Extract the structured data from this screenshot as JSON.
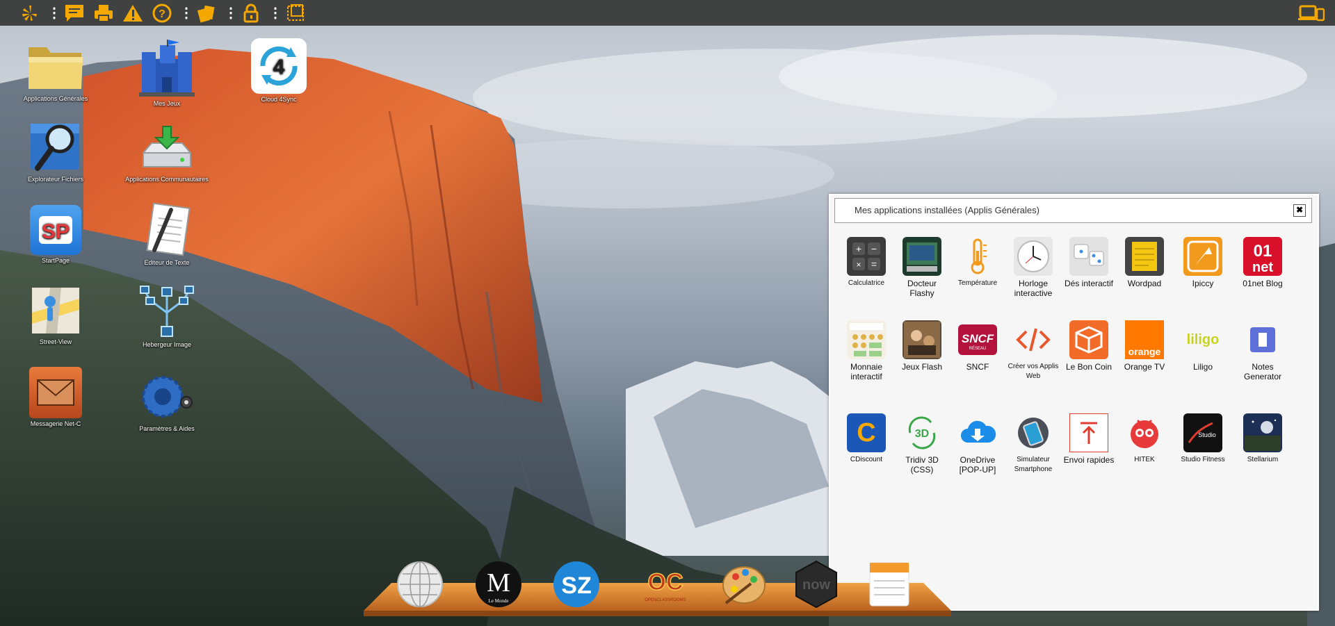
{
  "topbar": {
    "icons": [
      "yelp-icon",
      "chat-icon",
      "print-icon",
      "warning-icon",
      "help-icon",
      "notes-icon",
      "lock-icon",
      "selection-icon"
    ],
    "right_icon": "devices-icon"
  },
  "desktop": {
    "icons": [
      {
        "label": "Applications Générales",
        "icon": "folder-icon"
      },
      {
        "label": "Mes Jeux",
        "icon": "castle-icon"
      },
      {
        "label": "Cloud 4Sync",
        "icon": "cloud4sync-icon"
      },
      {
        "label": "Explorateur Fichiers",
        "icon": "magnifier-icon"
      },
      {
        "label": "Applications Communautaires",
        "icon": "download-drive-icon"
      },
      {
        "label": "StartPage",
        "icon": "startpage-icon"
      },
      {
        "label": "Editeur de Texte",
        "icon": "text-editor-icon"
      },
      {
        "label": "Street-View",
        "icon": "street-view-icon"
      },
      {
        "label": "Hebergeur Image",
        "icon": "image-host-icon"
      },
      {
        "label": "Messagerie Net-C",
        "icon": "mail-icon"
      },
      {
        "label": "Paramètres & Aides",
        "icon": "settings-icon"
      }
    ]
  },
  "window": {
    "title": "Mes applications installées (Applis Générales)",
    "close_label": "✖",
    "apps": [
      {
        "label": "Calculatrice",
        "icon": "calculator-icon"
      },
      {
        "label": "Docteur Flashy",
        "icon": "flashy-icon"
      },
      {
        "label": "Température",
        "icon": "thermometer-icon"
      },
      {
        "label": "Horloge interactive",
        "icon": "clock-icon"
      },
      {
        "label": "Dés interactif",
        "icon": "dice-icon"
      },
      {
        "label": "Wordpad",
        "icon": "wordpad-icon"
      },
      {
        "label": "Ipiccy",
        "icon": "ipiccy-icon"
      },
      {
        "label": "01net Blog",
        "icon": "01net-icon"
      },
      {
        "label": "Monnaie interactif",
        "icon": "money-icon"
      },
      {
        "label": "Jeux Flash",
        "icon": "flash-games-icon"
      },
      {
        "label": "SNCF",
        "icon": "sncf-icon"
      },
      {
        "label": "Créer vos Applis Web",
        "icon": "code-icon"
      },
      {
        "label": "Le Bon Coin",
        "icon": "box-icon"
      },
      {
        "label": "Orange TV",
        "icon": "orange-icon"
      },
      {
        "label": "Liligo",
        "icon": "liligo-icon"
      },
      {
        "label": "Notes Generator",
        "icon": "notes-generator-icon"
      },
      {
        "label": "CDiscount",
        "icon": "cdiscount-icon"
      },
      {
        "label": "Tridiv 3D (CSS)",
        "icon": "tridiv-icon"
      },
      {
        "label": "OneDrive [POP-UP]",
        "icon": "onedrive-icon"
      },
      {
        "label": "Simulateur Smartphone",
        "icon": "smartphone-icon"
      },
      {
        "label": "Envoi rapides",
        "icon": "upload-icon"
      },
      {
        "label": "HITEK",
        "icon": "hitek-icon"
      },
      {
        "label": "Studio Fitness",
        "icon": "studio-fitness-icon"
      },
      {
        "label": "Stellarium",
        "icon": "stellarium-icon"
      }
    ]
  },
  "dock": {
    "items": [
      {
        "icon": "wikipedia-icon"
      },
      {
        "icon": "le-monde-icon",
        "text": "M",
        "subtext": "Le Monde"
      },
      {
        "icon": "sz-icon",
        "text": "SZ"
      },
      {
        "icon": "openclassrooms-icon",
        "text": "OC",
        "subtext": "OPENCLASSROOMS"
      },
      {
        "icon": "paint-palette-icon"
      },
      {
        "icon": "cowork-now-icon",
        "text": "now"
      },
      {
        "icon": "notepad-icon"
      }
    ]
  },
  "colors": {
    "accent": "#f5a800",
    "topbar": "#404242"
  }
}
